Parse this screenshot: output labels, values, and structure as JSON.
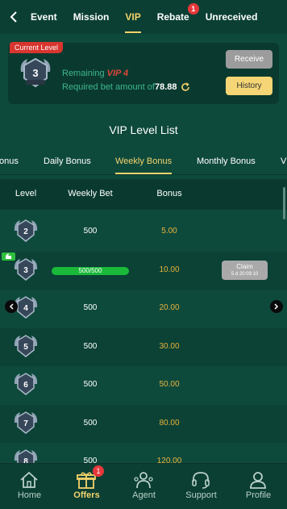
{
  "nav": {
    "tabs": [
      {
        "label": "Event"
      },
      {
        "label": "Mission"
      },
      {
        "label": "VIP",
        "active": true
      },
      {
        "label": "Rebate",
        "badge": "1"
      },
      {
        "label": "Unreceived"
      }
    ]
  },
  "level_card": {
    "tag": "Current Level",
    "badge_level": "3",
    "remaining_prefix": "Remaining",
    "remaining_vip": "VIP 4",
    "required_label": "Required bet amount of",
    "required_amount": "78.88",
    "receive_label": "Receive",
    "history_label": "History"
  },
  "list_title": "VIP Level List",
  "bonus_tabs": [
    {
      "label": "onus"
    },
    {
      "label": "Daily Bonus"
    },
    {
      "label": "Weekly Bonus",
      "active": true
    },
    {
      "label": "Monthly Bonus"
    },
    {
      "label": "V"
    }
  ],
  "table": {
    "headers": {
      "level": "Level",
      "bet": "Weekly Bet",
      "bonus": "Bonus"
    },
    "rows": [
      {
        "level": "2",
        "bet": "500",
        "bonus": "5.00"
      },
      {
        "level": "3",
        "progress": "500/500",
        "progress_value": 1.0,
        "bonus": "10.00",
        "claim": "Claim",
        "countdown": "5 d 20:09:10",
        "current": true
      },
      {
        "level": "4",
        "bet": "500",
        "bonus": "20.00"
      },
      {
        "level": "5",
        "bet": "500",
        "bonus": "30.00"
      },
      {
        "level": "6",
        "bet": "500",
        "bonus": "50.00"
      },
      {
        "level": "7",
        "bet": "500",
        "bonus": "80.00"
      },
      {
        "level": "8",
        "bet": "500",
        "bonus": "120.00"
      }
    ]
  },
  "bottom_nav": [
    {
      "label": "Home",
      "icon": "home-icon"
    },
    {
      "label": "Offers",
      "icon": "gift-icon",
      "badge": "1",
      "active": true
    },
    {
      "label": "Agent",
      "icon": "agent-icon"
    },
    {
      "label": "Support",
      "icon": "headset-icon"
    },
    {
      "label": "Profile",
      "icon": "profile-icon"
    }
  ],
  "colors": {
    "background": "#0e4a3c",
    "accent": "#f5d36b",
    "bonus_text": "#e8b23c",
    "badge_red": "#e5383b"
  }
}
